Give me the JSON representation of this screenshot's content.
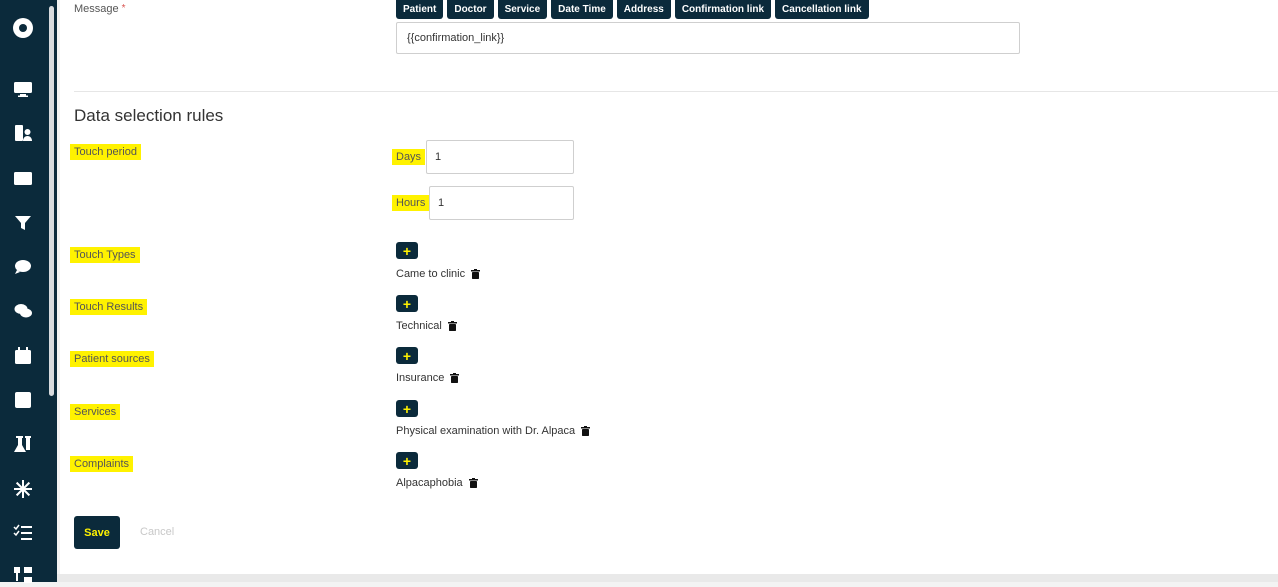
{
  "message": {
    "label": "Message",
    "required_mark": "*",
    "chips": [
      "Patient",
      "Doctor",
      "Service",
      "Date Time",
      "Address",
      "Confirmation link",
      "Cancellation link"
    ],
    "value": "{{confirmation_link}}"
  },
  "rules": {
    "title": "Data selection rules",
    "touch_period": {
      "label": "Touch period",
      "days_label": "Days",
      "days_value": "1",
      "hours_label": "Hours",
      "hours_value": "1"
    },
    "touch_types": {
      "label": "Touch Types",
      "add": "+",
      "item": "Came to clinic"
    },
    "touch_results": {
      "label": "Touch Results",
      "add": "+",
      "item": "Technical"
    },
    "patient_sources": {
      "label": "Patient sources",
      "add": "+",
      "item": "Insurance"
    },
    "services": {
      "label": "Services",
      "add": "+",
      "item": "Physical examination with Dr. Alpaca"
    },
    "complaints": {
      "label": "Complaints",
      "add": "+",
      "item": "Alpacaphobia"
    }
  },
  "actions": {
    "save": "Save",
    "cancel": "Cancel"
  },
  "colors": {
    "sidebar": "#0b2a3b",
    "accent": "#fff200",
    "highlight": "#fff200"
  },
  "sidebar_icons": [
    "logo-icon",
    "monitor-icon",
    "patients-icon",
    "id-card-icon",
    "filter-icon",
    "chat-icon",
    "conversations-icon",
    "calendar-icon",
    "medical-plus-icon",
    "lab-flask-icon",
    "snowflake-icon",
    "checklist-icon",
    "hierarchy-icon"
  ]
}
